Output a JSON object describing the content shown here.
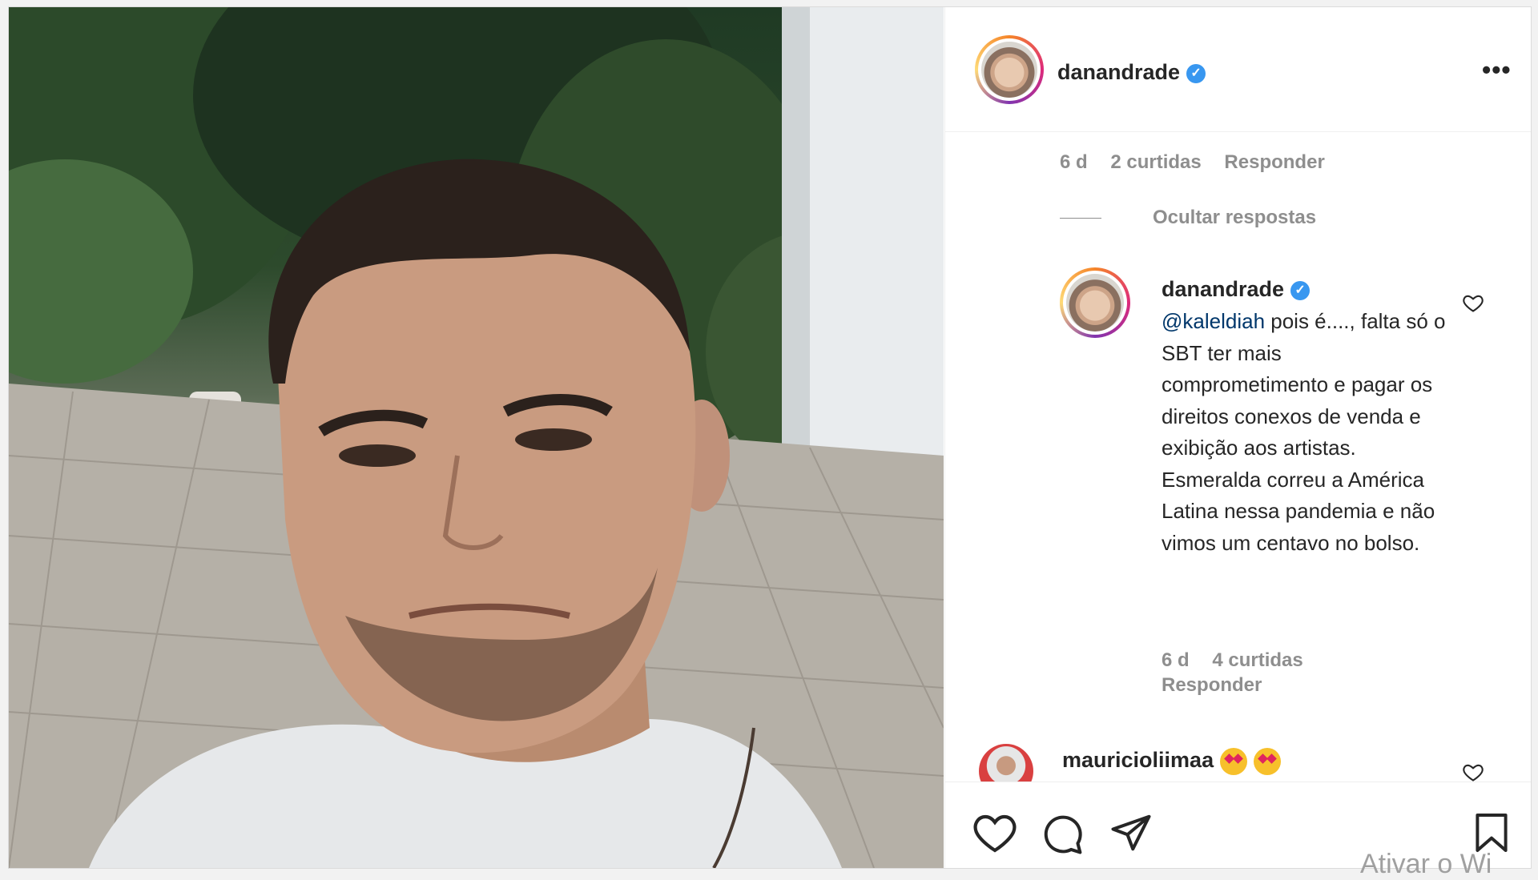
{
  "post": {
    "author": {
      "username": "danandrade",
      "verified": true
    },
    "more_label": "•••"
  },
  "comments": {
    "parent_meta": {
      "age": "6 d",
      "likes": "2 curtidas",
      "reply": "Responder"
    },
    "hide_replies": "Ocultar respostas",
    "reply": {
      "username": "danandrade",
      "mention": "@kaleldiah",
      "text": " pois é...., falta só o SBT ter mais comprometimento e pagar os direitos conexos de venda e exibição aos artistas. Esmeralda correu a América Latina nessa pandemia e não vimos um centavo no bolso.",
      "age": "6 d",
      "likes": "4 curtidas",
      "reply": "Responder"
    },
    "next": {
      "username": "mauricioliimaa",
      "emoji_icons": [
        "heart-eyes-emoji",
        "heart-eyes-emoji"
      ]
    }
  },
  "actions": {
    "icons": [
      "heart-icon",
      "comment-icon",
      "share-icon",
      "bookmark-icon"
    ]
  },
  "overlay": {
    "watermark": "Ativar o Wi"
  },
  "colors": {
    "verified_blue": "#3897f0",
    "mention": "#00376b",
    "meta_gray": "#8e8e8e",
    "text": "#262626"
  }
}
